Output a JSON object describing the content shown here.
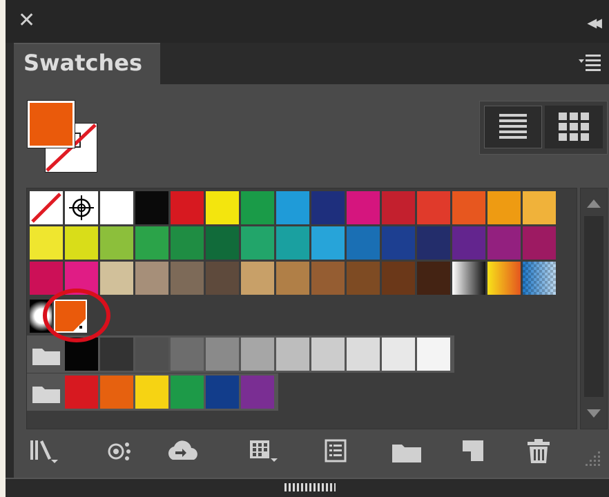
{
  "window": {
    "close_glyph": "✕",
    "collapse_glyph": "◀◀"
  },
  "tab": {
    "label": "Swatches"
  },
  "colors": {
    "fill": "#ea5a0b",
    "highlight_ring": "#d90f1c"
  },
  "swatch_rows": [
    [
      "none",
      "registration",
      "#ffffff",
      "#0a0a0a",
      "#d71920",
      "#f3e50e",
      "#1a9b48",
      "#1f9bd8",
      "#1e2f7d",
      "#d5157e",
      "#c3202e",
      "#e03a2b",
      "#e7571f",
      "#ee9b12",
      "#f0b23a"
    ],
    [
      "#efe62f",
      "#d9dd19",
      "#8cbf3b",
      "#2ba349",
      "#1f8d43",
      "#116b3a",
      "#22a56a",
      "#1aa0a0",
      "#27a4d9",
      "#1a6fb4",
      "#1d3f91",
      "#232d6b",
      "#63258e",
      "#93207f",
      "#9d1a62"
    ],
    [
      "#cc1057",
      "#e01c85",
      "#d1c09a",
      "#a68f79",
      "#7d6a58",
      "#5e4a3c",
      "#c8a068",
      "#b07f47",
      "#955d32",
      "#7e4b23",
      "#6b3819",
      "#442313",
      "grad-bw",
      "grad-yo",
      "grad-bt"
    ],
    [
      "grad-radial",
      "#ea5a0b"
    ],
    [
      "folder",
      "#050505",
      "#333333",
      "#4f4f4f",
      "#6d6d6d",
      "#8a8a8a",
      "#a6a6a6",
      "#bdbdbd",
      "#cccccc",
      "#dcdcdc",
      "#e8e8e8",
      "#f4f4f4"
    ],
    [
      "folder",
      "#d71920",
      "#e6610f",
      "#f6d313",
      "#1d9a48",
      "#123d8b",
      "#7a2e93"
    ]
  ],
  "toolbar_tools": [
    "swatch-libraries-icon",
    "show-kinds-icon",
    "cloud-sync-icon",
    "swatch-options-icon",
    "color-group-icon",
    "new-color-group-folder-icon",
    "new-swatch-icon",
    "delete-swatch-icon"
  ]
}
